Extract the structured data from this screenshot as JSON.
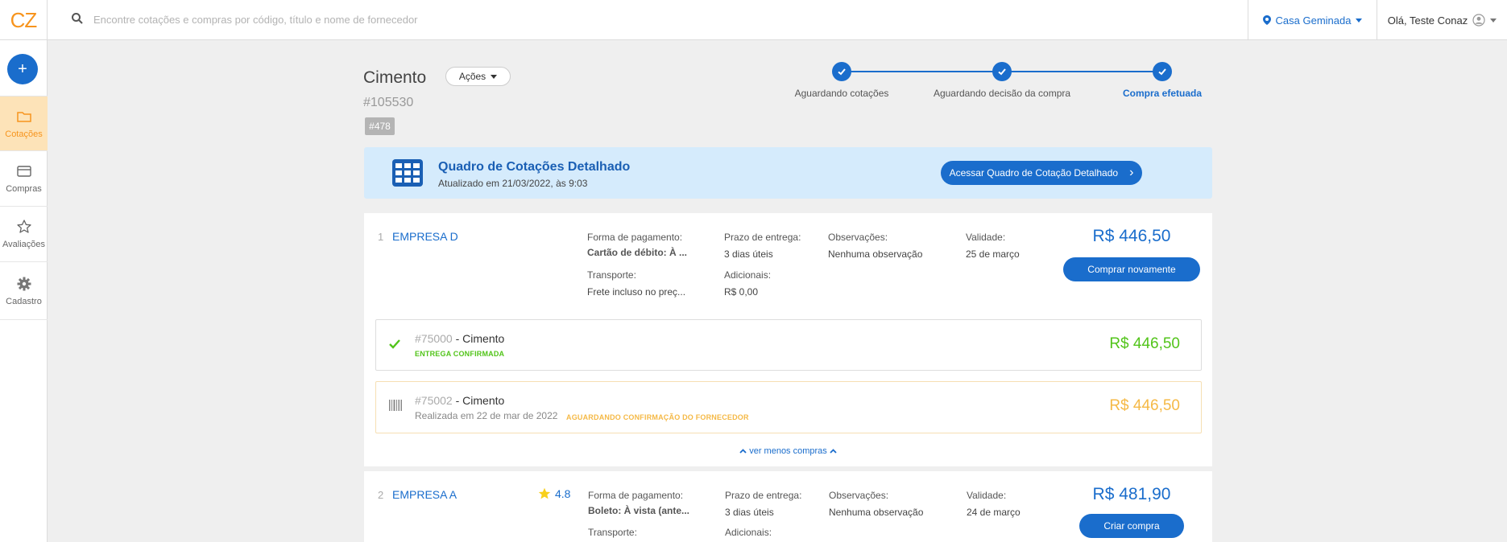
{
  "header": {
    "logo": "CZ",
    "search_placeholder": "Encontre cotações e compras por código, título e nome de fornecedor",
    "obra": "Casa Geminada",
    "greeting": "Olá, Teste Conaz"
  },
  "sidebar": {
    "add_label": "+",
    "items": [
      {
        "label": "Cotações",
        "icon": "folder-icon",
        "active": true
      },
      {
        "label": "Compras",
        "icon": "card-icon",
        "active": false
      },
      {
        "label": "Avaliações",
        "icon": "star-icon",
        "active": false
      },
      {
        "label": "Cadastro",
        "icon": "gear-icon",
        "active": false
      }
    ]
  },
  "page": {
    "title": "Cimento",
    "actions_label": "Ações",
    "code": "#105530",
    "tag": "#478"
  },
  "stepper": {
    "steps": [
      {
        "label": "Aguardando cotações",
        "done": true
      },
      {
        "label": "Aguardando decisão da compra",
        "done": true
      },
      {
        "label": "Compra efetuada",
        "done": true,
        "current": true
      }
    ]
  },
  "banner": {
    "title": "Quadro de Cotações Detalhado",
    "updated": "Atualizado em 21/03/2022, às 9:03",
    "button_label": "Acessar Quadro de Cotação Detalhado",
    "button_arrow": "›"
  },
  "labels": {
    "payment": "Forma de pagamento:",
    "delivery": "Prazo de entrega:",
    "notes": "Observações:",
    "validity": "Validade:",
    "transport": "Transporte:",
    "additional": "Adicionais:"
  },
  "suppliers": [
    {
      "index": "1",
      "name": "EMPRESA D",
      "payment": "Cartão de débito: À ...",
      "delivery": "3 dias úteis",
      "notes": "Nenhuma observação",
      "validity": "25 de março",
      "transport": "Frete incluso no preç...",
      "additional": "R$ 0,00",
      "price": "R$ 446,50",
      "button": "Comprar novamente",
      "orders": [
        {
          "number": "#75000",
          "title": " - Cimento",
          "status": "ENTREGA CONFIRMADA",
          "price": "R$ 446,50",
          "status_color": "#52c41a"
        },
        {
          "number": "#75002",
          "title": " - Cimento",
          "date": "Realizada em 22 de mar de 2022",
          "status": "AGUARDANDO CONFIRMAÇÃO DO FORNECEDOR",
          "price": "R$ 446,50",
          "status_color": "#f5b946"
        }
      ],
      "toggle_label": "ver menos compras"
    },
    {
      "index": "2",
      "name": "EMPRESA A",
      "rating": "4.8",
      "payment": "Boleto: À vista (ante...",
      "delivery": "3 dias úteis",
      "notes": "Nenhuma observação",
      "validity": "24 de março",
      "price": "R$ 481,90",
      "button": "Criar compra"
    }
  ],
  "colors": {
    "primary": "#1a6dcc",
    "brand_orange": "#f7941d",
    "success": "#52c41a",
    "warning": "#f5b946",
    "banner_bg": "#d5ebfc"
  }
}
